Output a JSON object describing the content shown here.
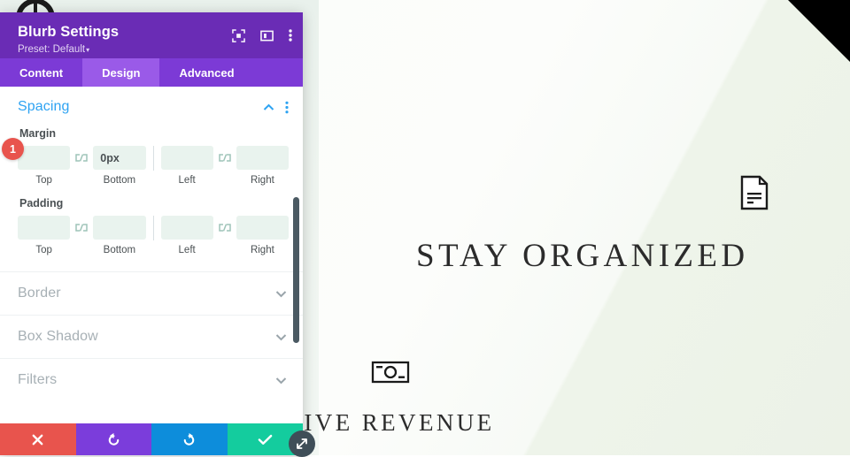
{
  "canvas": {
    "hero_title": "STAY ORGANIZED",
    "sub_title": "RIVE REVENUE",
    "sub_caption": "",
    "doc_icon": "document-icon",
    "money_icon": "banknote-icon",
    "logo_icon": "site-logo-icon",
    "corner_decoration": "black-corner-triangle"
  },
  "modal": {
    "title": "Blurb Settings",
    "preset_label": "Preset: Default",
    "preset_caret": "▾",
    "header_icons": [
      {
        "name": "focus-target-icon"
      },
      {
        "name": "layout-panel-icon"
      },
      {
        "name": "kebab-menu-icon"
      }
    ],
    "tabs": [
      {
        "label": "Content",
        "active": false
      },
      {
        "label": "Design",
        "active": true
      },
      {
        "label": "Advanced",
        "active": false
      }
    ],
    "spacing_section": {
      "title": "Spacing",
      "collapse_icon": "chevron-up-icon",
      "options_icon": "kebab-menu-icon",
      "badge": "1",
      "groups": [
        {
          "label": "Margin",
          "fields": [
            {
              "caption": "Top",
              "value": "",
              "placeholder": ""
            },
            {
              "caption": "Bottom",
              "value": "0px",
              "placeholder": ""
            },
            {
              "caption": "Left",
              "value": "",
              "placeholder": ""
            },
            {
              "caption": "Right",
              "value": "",
              "placeholder": ""
            }
          ]
        },
        {
          "label": "Padding",
          "fields": [
            {
              "caption": "Top",
              "value": "",
              "placeholder": ""
            },
            {
              "caption": "Bottom",
              "value": "",
              "placeholder": ""
            },
            {
              "caption": "Left",
              "value": "",
              "placeholder": ""
            },
            {
              "caption": "Right",
              "value": "",
              "placeholder": ""
            }
          ]
        }
      ]
    },
    "collapsed_sections": [
      {
        "label": "Border",
        "icon": "chevron-down-icon"
      },
      {
        "label": "Box Shadow",
        "icon": "chevron-down-icon"
      },
      {
        "label": "Filters",
        "icon": "chevron-down-icon"
      }
    ],
    "footer_buttons": [
      {
        "name": "cancel-button",
        "icon": "close-x-icon"
      },
      {
        "name": "undo-button",
        "icon": "undo-arrow-icon"
      },
      {
        "name": "redo-button",
        "icon": "redo-arrow-icon"
      },
      {
        "name": "save-button",
        "icon": "checkmark-icon"
      }
    ],
    "resize_handle_icon": "resize-diagonal-icon"
  },
  "colors": {
    "header_purple": "#6a2cb5",
    "tabbar_purple": "#7c3ad6",
    "active_tab_purple": "#9a5ae8",
    "section_blue": "#2ea3f2",
    "field_mint": "#e9f3ee",
    "badge_red": "#e8544d",
    "undo_purple": "#7b3ddb",
    "redo_blue": "#0d8ddb",
    "save_green": "#14cc9e"
  }
}
